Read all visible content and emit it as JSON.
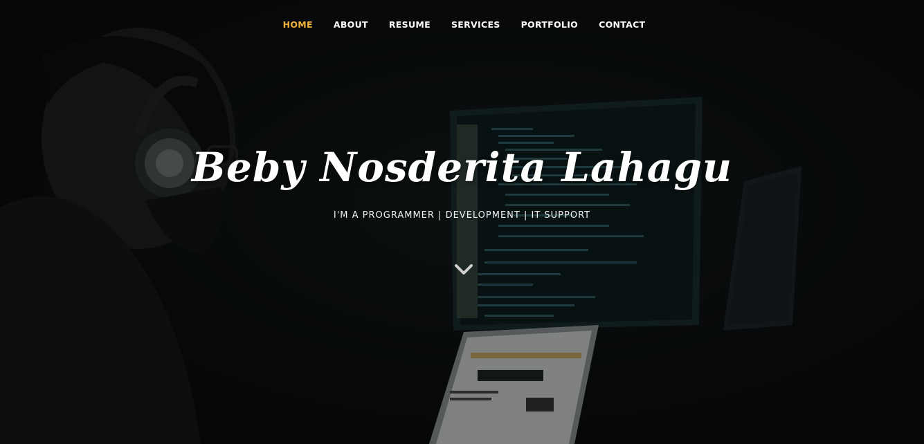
{
  "nav": {
    "items": [
      {
        "label": "HOME",
        "active": true
      },
      {
        "label": "ABOUT",
        "active": false
      },
      {
        "label": "RESUME",
        "active": false
      },
      {
        "label": "SERVICES",
        "active": false
      },
      {
        "label": "PORTFOLIO",
        "active": false
      },
      {
        "label": "CONTACT",
        "active": false
      }
    ],
    "active_color": "#f4b43c",
    "text_color": "#ffffff"
  },
  "hero": {
    "name": "Beby Nosderita Lahagu",
    "tagline": "I'M A PROGRAMMER | DEVELOPMENT | IT SUPPORT",
    "scroll_icon": "chevron-down-icon"
  }
}
